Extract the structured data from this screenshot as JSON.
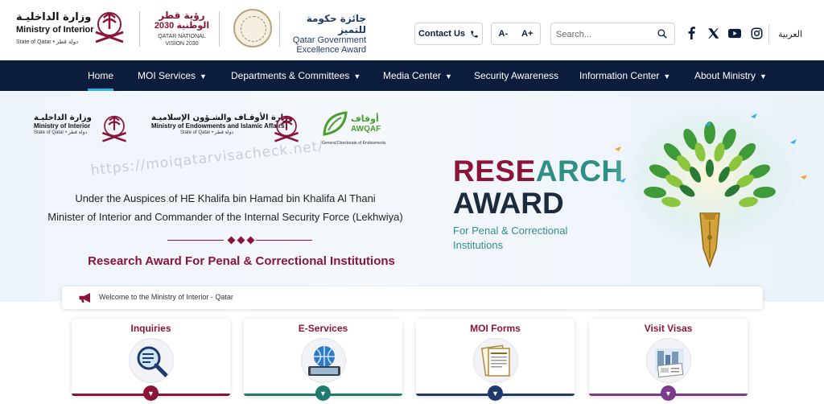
{
  "header": {
    "moi_logo": {
      "arabic": "وزارة الداخليـة",
      "english": "Ministry of Interior",
      "state": "State of Qatar • دولة قطر"
    },
    "vision_logo": {
      "arabic1": "رؤية قطر",
      "arabic2": "الوطنية 2030",
      "english": "QATAR NATIONAL VISION 2030"
    },
    "award_logo": {
      "arabic": "جائزة حكومة للتميز",
      "english_line1": "Qatar Government",
      "english_line2": "Excellence Award"
    },
    "contact_label": "Contact Us",
    "font_decrease": "A-",
    "font_increase": "A+",
    "search": {
      "placeholder": "Search..."
    },
    "social": [
      "facebook-icon",
      "x-icon",
      "youtube-icon",
      "instagram-icon"
    ],
    "language": "العربية"
  },
  "nav": {
    "items": [
      {
        "label": "Home",
        "active": true,
        "dropdown": false
      },
      {
        "label": "MOI Services",
        "dropdown": true
      },
      {
        "label": "Departments & Committees",
        "dropdown": true
      },
      {
        "label": "Media Center",
        "dropdown": true
      },
      {
        "label": "Security Awareness",
        "dropdown": false
      },
      {
        "label": "Information Center",
        "dropdown": true
      },
      {
        "label": "About Ministry",
        "dropdown": true
      }
    ]
  },
  "banner": {
    "partners": {
      "moi": {
        "arabic": "وزارة الداخليـة",
        "english": "Ministry of Interior",
        "state": "State of Qatar • دولة قطر"
      },
      "awqaf": {
        "arabic": "وزارة الأوقـاف والشـؤون الإسلاميـة",
        "english": "Ministry of Endowments and Islamic Affairs",
        "state": "State of Qatar • دولة قطر"
      },
      "endowments": {
        "arabic": "أوقاف",
        "english": "AWQAF",
        "sub": "General Directorate of Endowments"
      }
    },
    "watermark": "https://moiqatarvisacheck.net/",
    "auspices_line1": "Under the Auspices of HE Khalifa bin Hamad bin Khalifa Al Thani",
    "auspices_line2": "Minister of Interior and Commander of the Internal Security Force (Lekhwiya)",
    "award_title": "Research Award For Penal & Correctional Institutions",
    "headline_part1": "RESE",
    "headline_part2": "ARCH",
    "headline_line2": "AWARD",
    "subtitle_line1": "For Penal & Correctional",
    "subtitle_line2": "Institutions"
  },
  "welcome": {
    "text": "Welcome to the Ministry of Interior - Qatar"
  },
  "services": [
    {
      "label": "Inquiries",
      "color": "#8a1538"
    },
    {
      "label": "E-Services",
      "color": "#1f7a6f"
    },
    {
      "label": "MOI Forms",
      "color": "#1f3b6b"
    },
    {
      "label": "Visit Visas",
      "color": "#7a3b8a"
    }
  ],
  "colors": {
    "maroon": "#8a1538",
    "navy": "#0c1c3d",
    "teal": "#2e8f86",
    "nav_active": "#2fb0e5"
  }
}
